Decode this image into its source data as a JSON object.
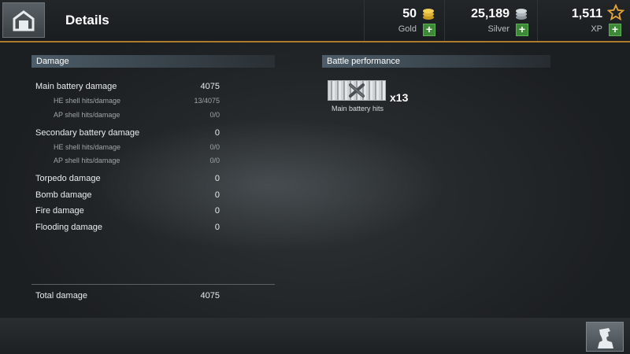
{
  "header": {
    "title": "Details",
    "currencies": [
      {
        "value": "50",
        "label": "Gold",
        "icon": "gold-coins-icon",
        "add_icon": "plus-icon"
      },
      {
        "value": "25,189",
        "label": "Silver",
        "icon": "silver-coins-icon",
        "add_icon": "plus-icon"
      },
      {
        "value": "1,511",
        "label": "XP",
        "icon": "star-icon",
        "add_icon": "plus-icon"
      }
    ],
    "home_icon": "port-icon"
  },
  "damage": {
    "heading": "Damage",
    "rows": [
      {
        "label": "Main battery damage",
        "value": "4075"
      },
      {
        "label": "HE shell hits/damage",
        "value": "13/4075"
      },
      {
        "label": "AP shell hits/damage",
        "value": "0/0"
      },
      {
        "label": "Secondary battery damage",
        "value": "0"
      },
      {
        "label": "HE shell hits/damage",
        "value": "0/0"
      },
      {
        "label": "AP shell hits/damage",
        "value": "0/0"
      },
      {
        "label": "Torpedo damage",
        "value": "0"
      },
      {
        "label": "Bomb damage",
        "value": "0"
      },
      {
        "label": "Fire damage",
        "value": "0"
      },
      {
        "label": "Flooding damage",
        "value": "0"
      }
    ],
    "total": {
      "label": "Total damage",
      "value": "4075"
    }
  },
  "performance": {
    "heading": "Battle performance",
    "medals": [
      {
        "label": "Main battery hits",
        "count": "x13",
        "icon": "crossed-shells-icon"
      }
    ]
  },
  "footer": {
    "captain_icon": "captain-icon"
  },
  "colors": {
    "accent": "#b07a2c",
    "plus": "#3c8a36",
    "section": "#4d5d69"
  }
}
